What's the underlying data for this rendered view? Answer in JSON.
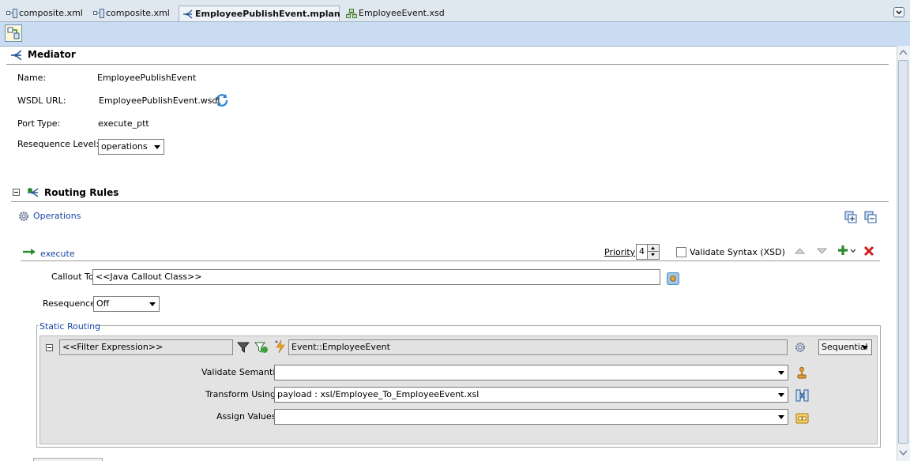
{
  "tabs": [
    {
      "label": "composite.xml"
    },
    {
      "label": "composite.xml"
    },
    {
      "label": "EmployeePublishEvent.mplan"
    },
    {
      "label": "EmployeeEvent.xsd"
    }
  ],
  "mediator": {
    "title": "Mediator",
    "name_label": "Name:",
    "name_value": "EmployeePublishEvent",
    "wsdl_label": "WSDL URL:",
    "wsdl_value": "EmployeePublishEvent.wsdl",
    "port_label": "Port Type:",
    "port_value": "execute_ptt",
    "reseq_label": "Resequence Level:",
    "reseq_value": "operations"
  },
  "routing": {
    "title": "Routing Rules",
    "operations_label": "Operations",
    "operation_name": "execute",
    "priority_label": "Priority",
    "priority_value": "4",
    "validate_syntax_label": "Validate Syntax (XSD)",
    "callout_label": "Callout To",
    "callout_value": "<<Java Callout Class>>",
    "reseq_label": "Resequence",
    "reseq_value": "Off",
    "static_routing_label": "Static Routing",
    "filter_value": "<<Filter Expression>>",
    "event_value": "Event::EmployeeEvent",
    "sequential_value": "Sequential",
    "validate_semantic_label": "Validate Semantic",
    "validate_semantic_value": "",
    "transform_label": "Transform Using",
    "transform_value": "payload : xsl/Employee_To_EmployeeEvent.xsl",
    "assign_label": "Assign Values",
    "assign_value": ""
  }
}
